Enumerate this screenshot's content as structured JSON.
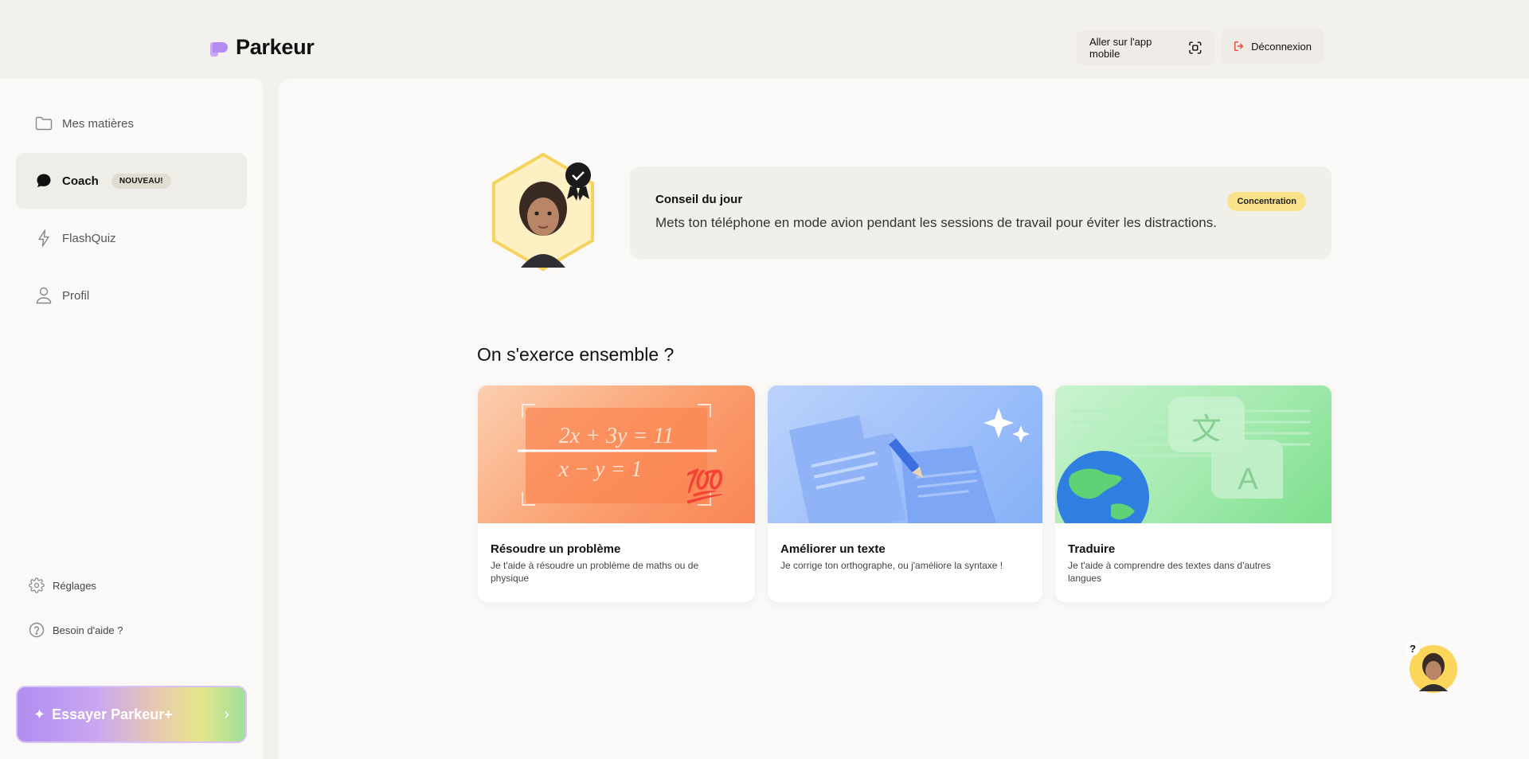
{
  "header": {
    "brand": "Parkeur",
    "mobile_app_label": "Aller sur l'app mobile",
    "logout_label": "Déconnexion"
  },
  "sidebar": {
    "items": [
      {
        "label": "Mes matières",
        "icon": "folder-icon"
      },
      {
        "label": "Coach",
        "icon": "chat-bubble-icon",
        "badge": "NOUVEAU!",
        "active": true
      },
      {
        "label": "FlashQuiz",
        "icon": "lightning-icon"
      },
      {
        "label": "Profil",
        "icon": "user-icon"
      }
    ],
    "settings_label": "Réglages",
    "help_label": "Besoin d'aide ?",
    "upgrade_label": "Essayer Parkeur+"
  },
  "tip": {
    "title": "Conseil du jour",
    "text": "Mets ton téléphone en mode avion pendant les sessions de travail pour éviter les distractions.",
    "tag": "Concentration"
  },
  "section": {
    "title": "On s'exerce ensemble ?"
  },
  "cards": [
    {
      "title": "Résoudre un problème",
      "desc": "Je t'aide à résoudre un problème de maths ou de physique",
      "eq1": "2x + 3y = 11",
      "eq2": "x − y = 1",
      "emoji": "💯"
    },
    {
      "title": "Améliorer un texte",
      "desc": "Je corrige ton orthographe, ou j'améliore la syntaxe !"
    },
    {
      "title": "Traduire",
      "desc": "Je t'aide à comprendre des textes dans d'autres langues",
      "glyph_cn": "文",
      "glyph_a": "A"
    }
  ],
  "help_bubble": {
    "mark": "?"
  },
  "colors": {
    "accent_purple": "#b48bf0",
    "logout_red": "#e0483a",
    "tag_yellow": "#fbe28a"
  }
}
